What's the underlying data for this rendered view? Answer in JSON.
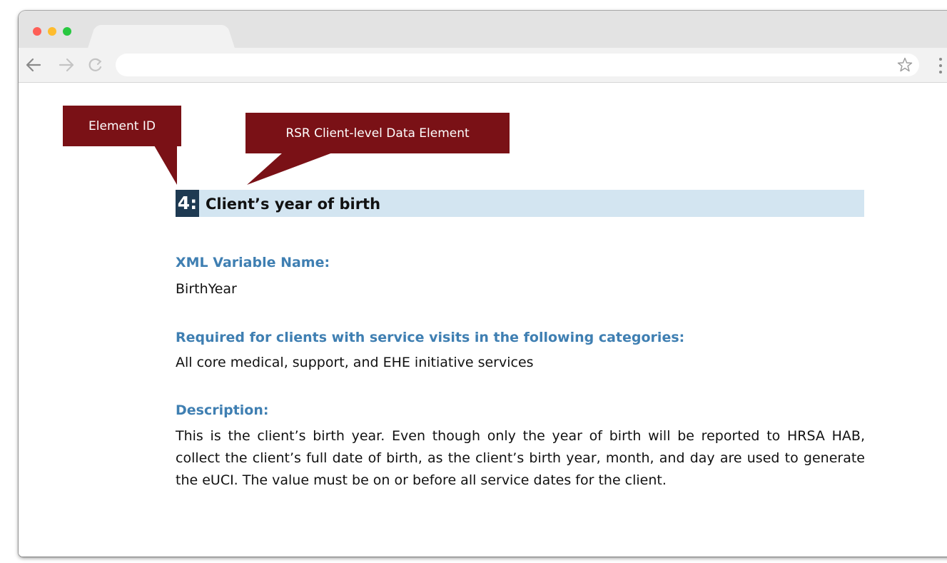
{
  "browser": {
    "traffic_lights": {
      "close": "#fe5f57",
      "minimize": "#febc2e",
      "maximize": "#28c840"
    },
    "tab_title": "",
    "address_bar_value": "",
    "icons": [
      "back-arrow-icon",
      "forward-arrow-icon",
      "reload-icon",
      "star-icon",
      "kebab-menu-icon"
    ]
  },
  "annotations": {
    "element_id_label": "Element ID",
    "data_element_label": "RSR Client-level Data Element",
    "color": "#7a1116"
  },
  "element": {
    "id": "4:",
    "title": "Client’s year of birth",
    "xml_label": "XML Variable Name:",
    "xml_value": "BirthYear",
    "required_label": "Required for clients with service visits in the following categories:",
    "required_value": "All core medical, support, and EHE initiative services",
    "description_label": "Description:",
    "description_text": "This is the client’s birth year. Even though only the year of birth will be reported to HRSA HAB, collect the client’s full date of birth, as the client’s birth year, month, and day are used to generate the eUCI. The value must be on or before all service dates for the client."
  },
  "colors": {
    "heading_bar": "#d3e5f1",
    "id_badge": "#1e3a52",
    "label_blue": "#3f7fb2"
  }
}
